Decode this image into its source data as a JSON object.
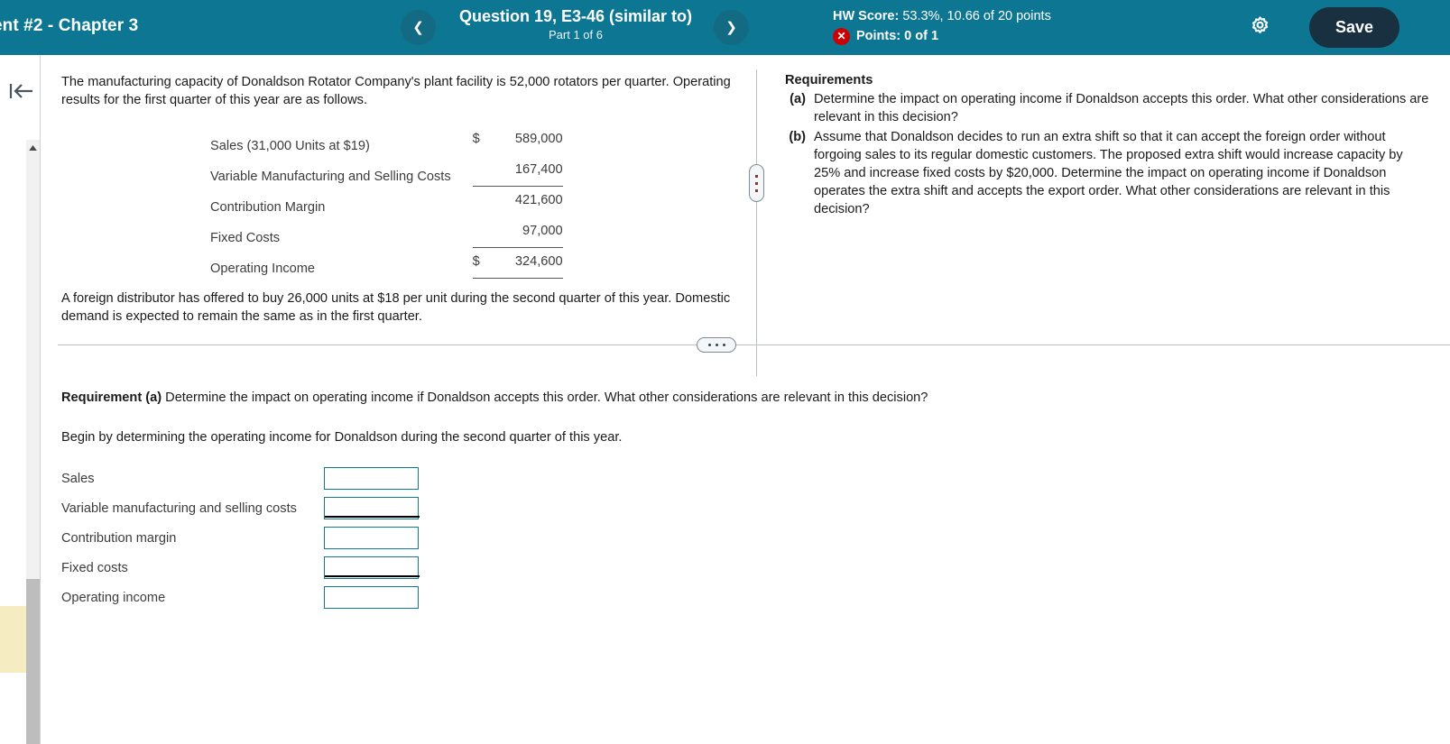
{
  "header": {
    "assignment_title": "ent #2 - Chapter 3",
    "prev_icon": "chevron-left-icon",
    "next_icon": "chevron-right-icon",
    "question_title": "Question 19, E3-46 (similar to)",
    "question_part": "Part 1 of 6",
    "hw_score_label": "HW Score:",
    "hw_score_value": "53.3%, 10.66 of 20 points",
    "incorrect_icon": "✕",
    "points_label": "Points:",
    "points_value": "0 of 1",
    "gear_icon": "gear-icon",
    "save_label": "Save",
    "bg_color": "#0d7793",
    "save_bg_color": "#18303f"
  },
  "left_rail": {
    "collapse_icon": "collapse-left-icon",
    "scroll_up_icon": "▲",
    "highlight_color": "#f6ecc1"
  },
  "problem": {
    "intro": "The manufacturing capacity of Donaldson Rotator Company's plant facility is 52,000 rotators per quarter. Operating results for the first quarter of this year are as follows.",
    "table": [
      {
        "label": "Sales (31,000 Units at $19)",
        "currency": "$",
        "value": "589,000",
        "ruled": false
      },
      {
        "label": "Variable Manufacturing and Selling Costs",
        "currency": "",
        "value": "167,400",
        "ruled": true
      },
      {
        "label": "Contribution Margin",
        "currency": "",
        "value": "421,600",
        "ruled": false
      },
      {
        "label": "Fixed Costs",
        "currency": "",
        "value": "97,000",
        "ruled": true
      },
      {
        "label": "Operating Income",
        "currency": "$",
        "value": "324,600",
        "ruled": true
      }
    ],
    "closing_note": "A foreign distributor has offered to buy 26,000 units at $18 per unit during the second quarter of this year. Domestic demand is expected to remain the same as in the first quarter."
  },
  "requirements": {
    "heading": "Requirements",
    "items": [
      {
        "marker": "(a)",
        "text": "Determine the impact on operating income if Donaldson accepts this order. What other considerations are relevant in this decision?"
      },
      {
        "marker": "(b)",
        "text": "Assume that Donaldson decides to run an extra shift so that it can accept the foreign order without forgoing sales to its regular domestic customers. The proposed extra shift would increase capacity by 25% and increase fixed costs by $20,000. Determine the impact on operating income if Donaldson operates the extra shift and accepts the export order. What other considerations are relevant in this decision?"
      }
    ]
  },
  "answer": {
    "requirement_label": "Requirement (a)",
    "requirement_text": " Determine the impact on operating income if Donaldson accepts this order. What other considerations are relevant in this decision?",
    "begin_instruction": "Begin by determining the operating income for Donaldson during the second quarter of this year.",
    "rows": [
      {
        "label": "Sales",
        "value": "",
        "ruled": false
      },
      {
        "label": "Variable manufacturing and selling costs",
        "value": "",
        "ruled": true
      },
      {
        "label": "Contribution margin",
        "value": "",
        "ruled": false
      },
      {
        "label": "Fixed costs",
        "value": "",
        "ruled": true
      },
      {
        "label": "Operating income",
        "value": "",
        "ruled": false
      }
    ],
    "input_border_color": "#0d7b99"
  }
}
